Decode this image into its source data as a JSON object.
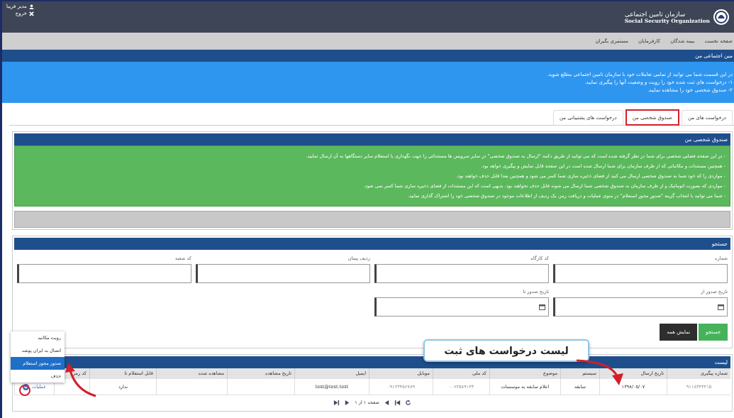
{
  "header": {
    "user": "مدیر فریبا",
    "logout": "خروج",
    "logo_title": "سازمان تامین اجتماعی",
    "logo_subtitle": "Social Security Organization"
  },
  "nav": [
    "صفحه نخست",
    "بیمه شدگان",
    "کارفرمایان",
    "مستمری بگیران"
  ],
  "page_title": "مین اجتماعی من",
  "intro": [
    "در این قسمت شما می توانید از تمامی تعاملات خود با سازمان تامین اجتماعی مطلع شوید.",
    "۱- درخواست های ثبت شده خود را رویت و وضعیت آنها را پیگیری نمایید.",
    "۲- صندوق شخصی خود را مشاهده نمایید."
  ],
  "tabs": [
    {
      "label": "درخواست های من",
      "selected": false,
      "circled": false
    },
    {
      "label": "صندوق شخصی من",
      "selected": true,
      "circled": true
    },
    {
      "label": "درخواست های پشتیبانی من",
      "selected": false,
      "circled": false
    }
  ],
  "personal_box": {
    "title": "صندوق شخصی من",
    "notes": [
      "- در این صفحه فضایی شخصی برای شما در نظر گرفته شده است که می توانید از طریق دکمه \"ارسال به صندوق شخصی\" در سایر سرویس ها مستنداتی را جهت نگهداری یا استعلام سایر دستگاهها به آن ارسال نمایید.",
      "- همچنین مستندات و مکاتباتی که از طرف سازمان برای شما ارسال شده است در این صفحه قابل نمایش و پیگیری خواهد بود.",
      "- مواردی را که خود شما به صندوق شخصی ارسال می کنید از فضای ذخیره سازی شما کسر می شود و همچنین بعدا قابل حذف خواهند بود.",
      "- مواردی که بصورت اتوماتیک و از طرف سازمان به صندوق شخصی شما ارسال می شوند قابل حذف نخواهند بود. بدیهی است که این مستندات از فضای ذخیره سازی شما کسر نمی شود.",
      "- شما می توانید با انتخاب گزینه \"صدور مجوز استعلام\" در منوی عملیات و دریافت رمز، یک ردیف از اطلاعات موجود در صندوق شخصی خود را اشتراک گذاری نمایید."
    ]
  },
  "search": {
    "title": "جستجو",
    "fields": [
      {
        "label": "شماره",
        "kind": "text"
      },
      {
        "label": "کد کارگاه",
        "kind": "text"
      },
      {
        "label": "ردیف پیمان",
        "kind": "text"
      },
      {
        "label": "کد شعبه",
        "kind": "text"
      },
      {
        "label": "تاریخ صدور از",
        "kind": "date"
      },
      {
        "label": "تاریخ صدور تا",
        "kind": "date"
      }
    ],
    "buttons": [
      {
        "label": "جستجو",
        "kind": "primary"
      },
      {
        "label": "نمایش همه",
        "kind": "dark"
      }
    ]
  },
  "list": {
    "title": "لیست",
    "columns": [
      "شماره پیگیری",
      "تاریخ ارسال",
      "سیستم",
      "موضوع",
      "کد ملی",
      "موبایل",
      "ایمیل",
      "تاریخ مشاهده",
      "مشاهده شده",
      "قابل استعلام تا",
      "کد رمز"
    ],
    "rows": [
      {
        "cells": [
          "۹۱۱۸۳۲۴۲۱۵",
          "۱۳۹۸/۰۵/۰۷",
          "سابقه",
          "اعلام سابقه به موسسات",
          "۰۰۶۲۵۸۹۱۴۳",
          "۰۹۱۲۳۴۵۶۷۸۹",
          "test@test.test",
          null,
          null,
          "ندارد",
          null
        ],
        "action": "عملیات"
      }
    ],
    "pager": "صفحه ۱ از ۱"
  },
  "action_menu": [
    {
      "label": "رویت مکاتبه",
      "selected": false
    },
    {
      "label": "اتصال به ایران پوشه",
      "selected": false
    },
    {
      "label": "صدور مجوز استعلام",
      "selected": true
    },
    {
      "label": "حذف",
      "selected": false
    }
  ],
  "callout": {
    "text": "لیست درخواست های ثبت"
  }
}
